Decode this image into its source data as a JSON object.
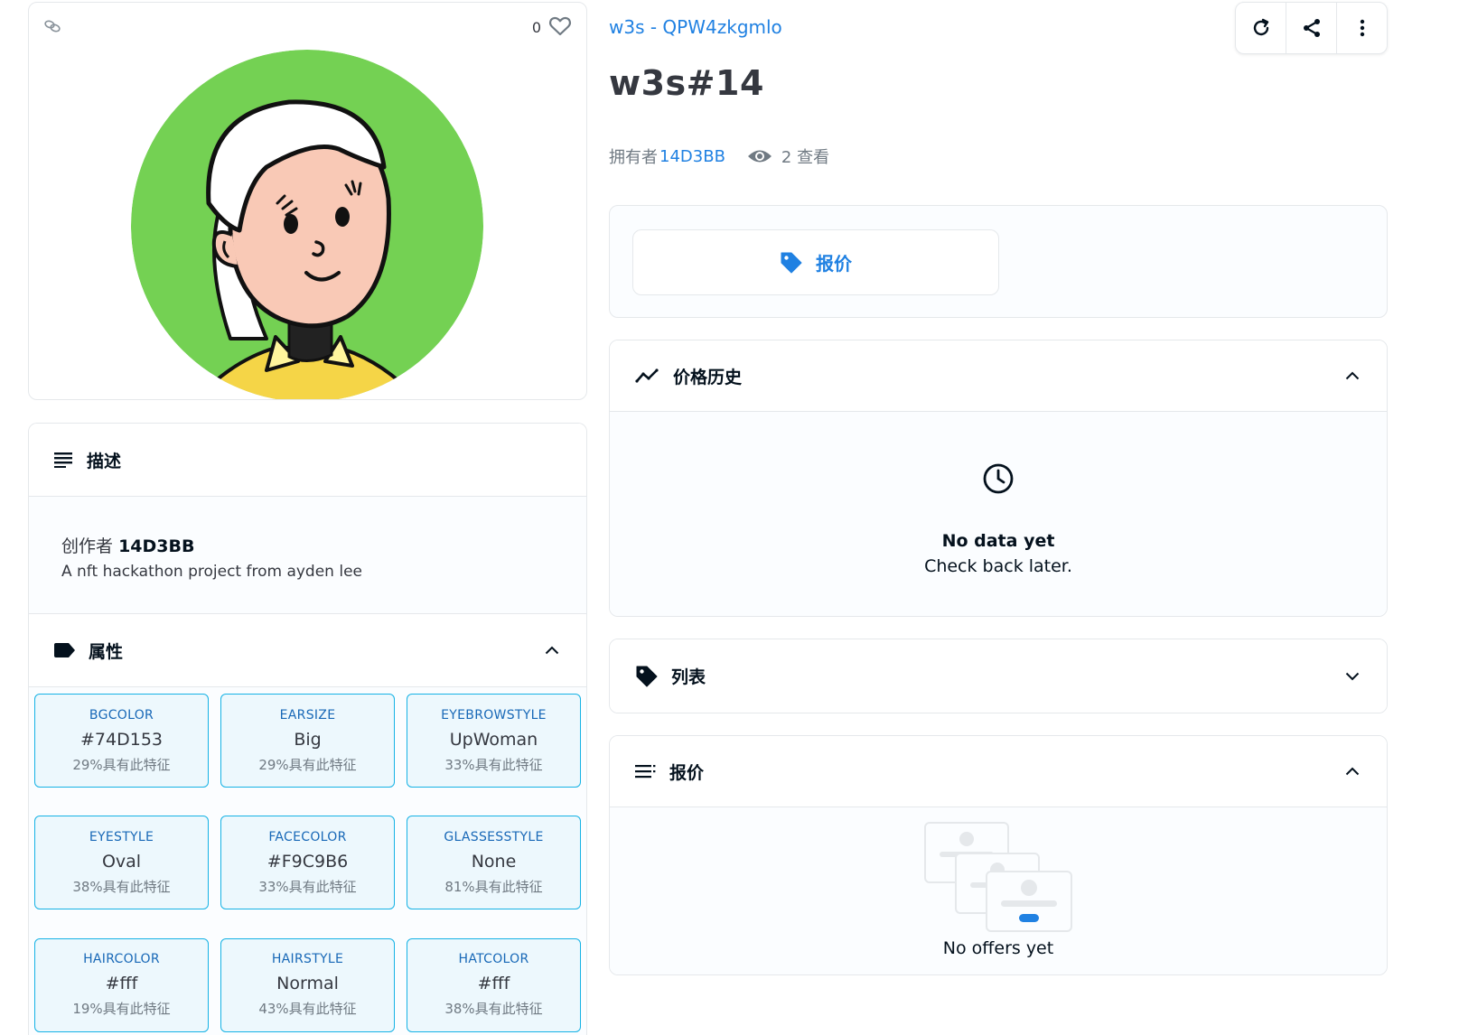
{
  "image_card": {
    "favorite_count": "0",
    "avatar_bgcolor": "#74D153"
  },
  "description": {
    "title": "描述",
    "creator_prefix": "创作者",
    "creator_name": "14D3BB",
    "text": "A nft hackathon project from ayden lee"
  },
  "attributes": {
    "title": "属性",
    "traits": [
      {
        "type": "BGCOLOR",
        "value": "#74D153",
        "rarity": "29%具有此特征"
      },
      {
        "type": "EARSIZE",
        "value": "Big",
        "rarity": "29%具有此特征"
      },
      {
        "type": "EYEBROWSTYLE",
        "value": "UpWoman",
        "rarity": "33%具有此特征"
      },
      {
        "type": "EYESTYLE",
        "value": "Oval",
        "rarity": "38%具有此特征"
      },
      {
        "type": "FACECOLOR",
        "value": "#F9C9B6",
        "rarity": "33%具有此特征"
      },
      {
        "type": "GLASSESSTYLE",
        "value": "None",
        "rarity": "81%具有此特征"
      },
      {
        "type": "HAIRCOLOR",
        "value": "#fff",
        "rarity": "19%具有此特征"
      },
      {
        "type": "HAIRSTYLE",
        "value": "Normal",
        "rarity": "43%具有此特征"
      },
      {
        "type": "HATCOLOR",
        "value": "#fff",
        "rarity": "38%具有此特征"
      }
    ]
  },
  "header": {
    "collection_link": "w3s - QPW4zkgmlo",
    "item_title": "w3s#14",
    "owner_prefix": "拥有者",
    "owner_name": "14D3BB",
    "views": "2 查看"
  },
  "offer_box": {
    "make_offer_label": "报价"
  },
  "price_history": {
    "title": "价格历史",
    "empty_title": "No data yet",
    "empty_sub": "Check back later."
  },
  "listings": {
    "title": "列表"
  },
  "offers": {
    "title": "报价",
    "empty_text": "No offers yet"
  },
  "colors": {
    "accent": "#2081e2",
    "trait_border": "#15b2e5",
    "border": "#e5e8eb",
    "face": "#F9C9B6",
    "avatar_bg": "#74D153"
  },
  "icons": [
    "chain-link-icon",
    "heart-icon",
    "refresh-icon",
    "share-icon",
    "more-vertical-icon",
    "eye-icon",
    "tag-icon",
    "trend-line-icon",
    "chevron-up-icon",
    "chevron-down-icon",
    "clock-icon",
    "list-icon",
    "label-icon",
    "offers-empty-illustration"
  ]
}
